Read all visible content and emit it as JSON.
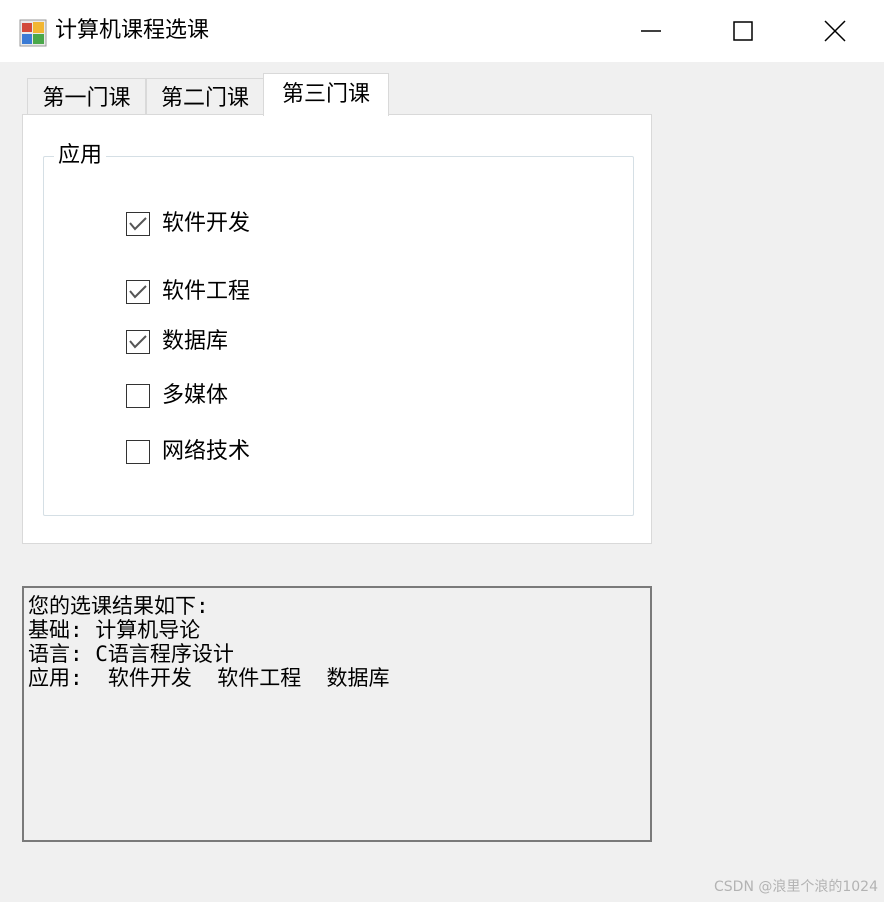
{
  "window": {
    "title": "计算机课程选课",
    "icon": "windows-forms-app-icon",
    "controls": [
      "minimize-icon",
      "maximize-icon",
      "close-icon"
    ]
  },
  "tabs": [
    {
      "label": "第一门课",
      "selected": false
    },
    {
      "label": "第二门课",
      "selected": false
    },
    {
      "label": "第三门课",
      "selected": true
    }
  ],
  "group": {
    "title": "应用",
    "options": [
      {
        "label": "软件开发",
        "checked": true
      },
      {
        "label": "软件工程",
        "checked": true
      },
      {
        "label": "数据库",
        "checked": true
      },
      {
        "label": "多媒体",
        "checked": false
      },
      {
        "label": "网络技术",
        "checked": false
      }
    ]
  },
  "result": {
    "lines": [
      "您的选课结果如下:",
      "基础: 计算机导论",
      "语言: C语言程序设计",
      "应用:  软件开发  软件工程  数据库"
    ]
  },
  "watermark": "CSDN @浪里个浪的1024",
  "colors": {
    "title_bg": "#ffffff",
    "window_bg": "#f0f0f0",
    "check_mark": "#555555",
    "watermark": "#b3b3b3"
  }
}
